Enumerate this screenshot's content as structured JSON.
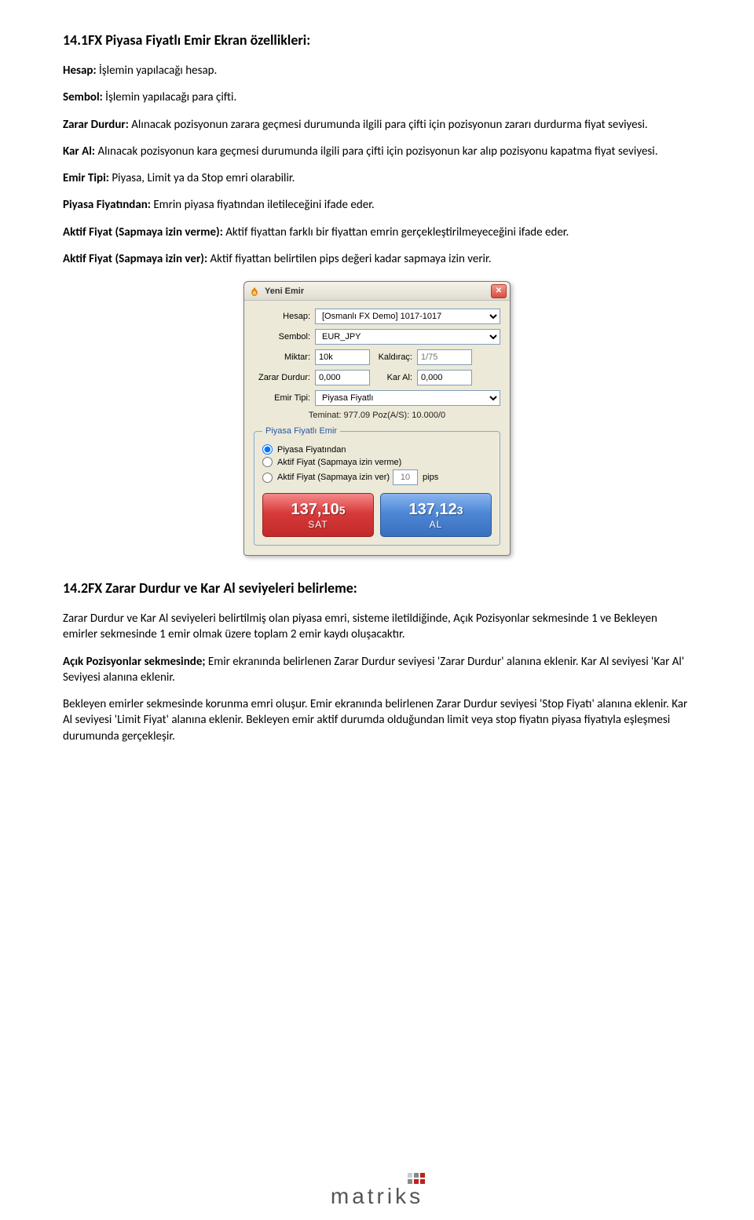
{
  "doc": {
    "h1": "14.1FX Piyasa Fiyatlı Emir Ekran özellikleri:",
    "p_hesap_b": "Hesap:",
    "p_hesap": " İşlemin yapılacağı hesap.",
    "p_sembol_b": "Sembol:",
    "p_sembol": " İşlemin yapılacağı para çifti.",
    "p_zd_b": "Zarar Durdur:",
    "p_zd": " Alınacak pozisyonun zarara geçmesi durumunda ilgili para çifti için pozisyonun zararı durdurma fiyat seviyesi.",
    "p_ka_b": "Kar Al:",
    "p_ka": " Alınacak pozisyonun kara geçmesi durumunda ilgili para çifti için pozisyonun kar alıp pozisyonu kapatma fiyat seviyesi.",
    "p_et_b": "Emir Tipi:",
    "p_et": " Piyasa, Limit ya da Stop emri olarabilir.",
    "p_pf_b": "Piyasa Fiyatından:",
    "p_pf": " Emrin piyasa fiyatından iletileceğini ifade eder.",
    "p_af1_b": "Aktif Fiyat (Sapmaya izin verme):",
    "p_af1": " Aktif fiyattan farklı bir fiyattan emrin gerçekleştirilmeyeceğini ifade eder.",
    "p_af2_b": "Aktif Fiyat (Sapmaya izin ver):",
    "p_af2": " Aktif fiyattan belirtilen pips değeri kadar sapmaya izin verir.",
    "h2": "14.2FX Zarar Durdur ve Kar Al seviyeleri belirleme:",
    "p2_1": "Zarar Durdur ve Kar Al seviyeleri belirtilmiş olan piyasa emri, sisteme iletildiğinde, Açık Pozisyonlar sekmesinde 1 ve Bekleyen emirler sekmesinde 1 emir olmak üzere toplam 2 emir kaydı oluşacaktır.",
    "p2_2_b": "Açık Pozisyonlar sekmesinde;",
    "p2_2": " Emir ekranında belirlenen Zarar Durdur seviyesi 'Zarar Durdur' alanına eklenir. Kar Al seviyesi 'Kar Al' Seviyesi alanına eklenir.",
    "p2_3": "Bekleyen emirler sekmesinde korunma emri oluşur. Emir ekranında belirlenen Zarar Durdur seviyesi 'Stop Fiyatı' alanına eklenir. Kar Al seviyesi 'Limit Fiyat' alanına eklenir. Bekleyen emir aktif durumda olduğundan limit veya stop fiyatın piyasa fiyatıyla eşleşmesi durumunda gerçekleşir."
  },
  "dialog": {
    "title": "Yeni Emir",
    "labels": {
      "hesap": "Hesap:",
      "sembol": "Sembol:",
      "miktar": "Miktar:",
      "kaldirac": "Kaldıraç:",
      "zarar": "Zarar Durdur:",
      "kar": "Kar Al:",
      "emirtipi": "Emir Tipi:"
    },
    "values": {
      "hesap": "[Osmanlı FX Demo] 1017-1017",
      "sembol": "EUR_JPY",
      "miktar": "10k",
      "kaldirac": "1/75",
      "zarar": "0,000",
      "kar": "0,000",
      "emirtipi": "Piyasa Fiyatlı"
    },
    "info": "Teminat: 977.09     Poz(A/S): 10.000/0",
    "fieldset_legend": "Piyasa Fiyatlı Emir",
    "radios": {
      "r1": "Piyasa Fiyatından",
      "r2": "Aktif Fiyat (Sapmaya izin verme)",
      "r3": "Aktif Fiyat (Sapmaya izin ver)",
      "pips_val": "10",
      "pips_lbl": "pips"
    },
    "sell": {
      "big": "137,10",
      "small": "5",
      "label": "SAT"
    },
    "buy": {
      "big": "137,12",
      "small": "3",
      "label": "AL"
    }
  },
  "logo": {
    "text": "matriks"
  }
}
